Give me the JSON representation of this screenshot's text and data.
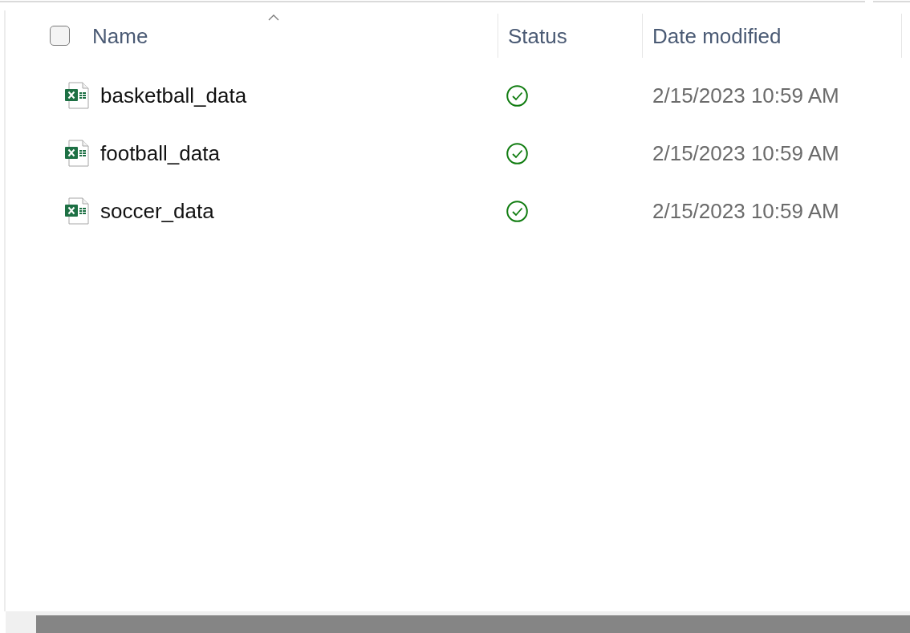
{
  "select_all": {
    "checked": false
  },
  "columns": [
    {
      "label": "Name",
      "sorted": true
    },
    {
      "label": "Status",
      "sorted": false
    },
    {
      "label": "Date modified",
      "sorted": false
    }
  ],
  "files": [
    {
      "name": "basketball_data",
      "synced": true,
      "date_modified": "2/15/2023 10:59 AM"
    },
    {
      "name": "football_data",
      "synced": true,
      "date_modified": "2/15/2023 10:59 AM"
    },
    {
      "name": "soccer_data",
      "synced": true,
      "date_modified": "2/15/2023 10:59 AM"
    }
  ]
}
